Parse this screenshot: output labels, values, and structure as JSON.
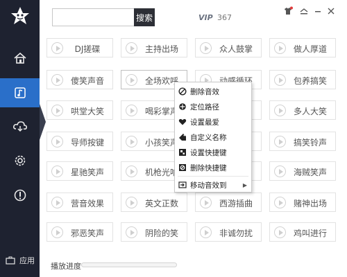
{
  "header": {
    "search_placeholder": "",
    "search_button": "搜索",
    "vip_logo": "VIP",
    "vip_count": "367"
  },
  "sidebar": {
    "items": [
      {
        "icon": "home-icon"
      },
      {
        "icon": "music-note-icon",
        "active": true
      },
      {
        "icon": "cloud-icon"
      },
      {
        "icon": "gear-icon"
      },
      {
        "icon": "exclamation-circle-icon"
      }
    ],
    "app_label": "应用"
  },
  "grid": {
    "rows": [
      [
        "DJ搓碟",
        "主持出场",
        "众人鼓掌",
        "做人厚道"
      ],
      [
        "傻笑声音",
        "全场欢呼",
        "动感循环",
        "包养搞笑"
      ],
      [
        "哄堂大笑",
        "喝彩掌声",
        "",
        "多人大笑"
      ],
      [
        "导师按键",
        "小孩笑声",
        "",
        "搞笑铃声"
      ],
      [
        "星驰笑声",
        "机枪光响",
        "",
        "海贼笑声"
      ],
      [
        "营音效果",
        "英文正数",
        "西游插曲",
        "赌神出场"
      ],
      [
        "邪恶笑声",
        "阴险的笑",
        "非诚勿扰",
        "鸡叫进行"
      ]
    ]
  },
  "context_menu": {
    "items": [
      {
        "label": "删除音效",
        "icon": "ban-icon"
      },
      {
        "label": "定位路径",
        "icon": "crosshair-icon"
      },
      {
        "label": "设置最爱",
        "icon": "heart-icon"
      },
      {
        "label": "自定义名称",
        "icon": "tag-icon"
      },
      {
        "label": "设置快捷键",
        "icon": "keyboard-icon"
      },
      {
        "label": "删除快捷键",
        "icon": "remove-shortcut-icon"
      },
      {
        "label": "移动音效到",
        "icon": "move-icon",
        "has_submenu": true
      }
    ]
  },
  "footer": {
    "progress_label": "播放进度",
    "progress": 0
  },
  "colors": {
    "sidebar_bg": "#1e2230",
    "accent": "#2a6fc9",
    "search_button_bg": "#2d2f36"
  }
}
